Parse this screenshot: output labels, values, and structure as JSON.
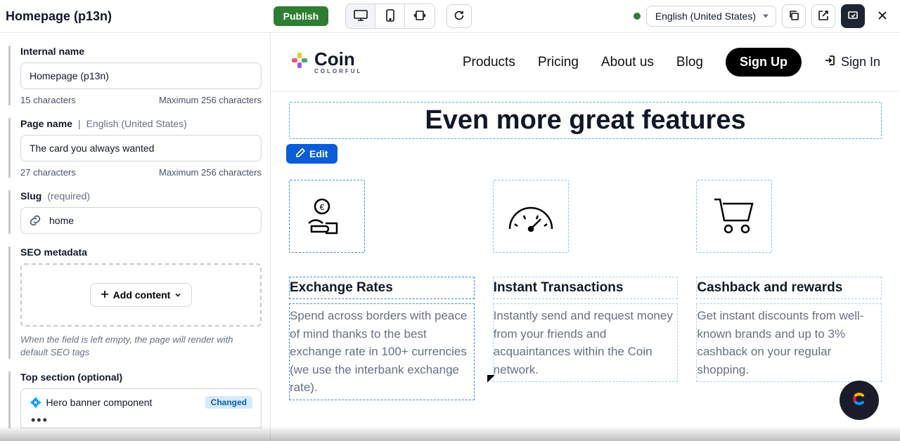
{
  "header": {
    "title": "Homepage (p13n)",
    "publish": "Publish",
    "locale": "English (United States)"
  },
  "sidebar": {
    "internal_name": {
      "label": "Internal name",
      "value": "Homepage (p13n)",
      "count": "15 characters",
      "max": "Maximum 256 characters"
    },
    "page_name": {
      "label": "Page name",
      "locale_prefix": "|",
      "locale": "English (United States)",
      "value": "The card you always wanted",
      "count": "27 characters",
      "max": "Maximum 256 characters"
    },
    "slug": {
      "label": "Slug",
      "required": "(required)",
      "value": "home"
    },
    "seo": {
      "label": "SEO metadata",
      "add": "Add content",
      "hint": "When the field is left empty, the page will render with default SEO tags"
    },
    "topsection": {
      "label": "Top section (optional)",
      "component": "Hero banner component",
      "status": "Changed"
    }
  },
  "site": {
    "brand": "Coin",
    "brand_sub": "COLORFUL",
    "nav": {
      "products": "Products",
      "pricing": "Pricing",
      "about": "About us",
      "blog": "Blog"
    },
    "signup": "Sign Up",
    "signin": "Sign In"
  },
  "preview": {
    "heading": "Even more great features",
    "edit": "Edit",
    "features": {
      "f1": {
        "title": "Exchange Rates",
        "desc": "Spend across borders with peace of mind thanks to the best exchange rate in 100+ currencies (we use the interbank exchange rate)."
      },
      "f2": {
        "title": "Instant Transactions",
        "desc": "Instantly send and request money from your friends and acquaintances within the Coin network."
      },
      "f3": {
        "title": "Cashback and rewards",
        "desc": "Get instant discounts from well-known brands and up to 3% cashback on your regular shopping."
      }
    }
  }
}
